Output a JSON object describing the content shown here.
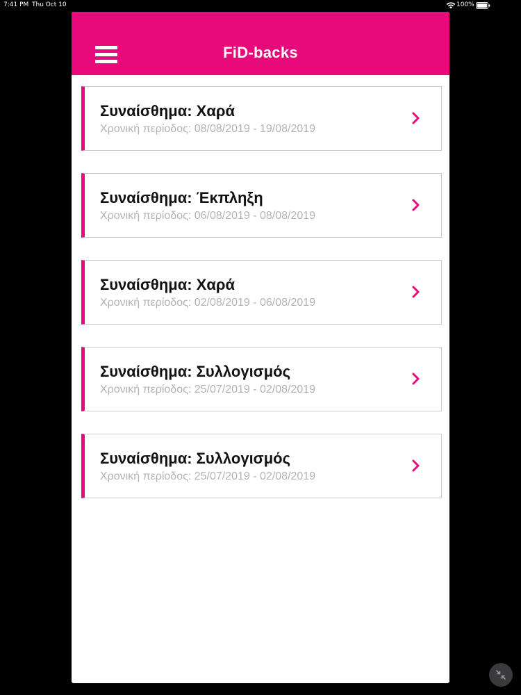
{
  "status_bar": {
    "time": "7:41 PM",
    "date": "Thu Oct 10",
    "battery": "100%",
    "icons": [
      "wifi-icon",
      "battery-icon"
    ]
  },
  "header": {
    "title": "FiD-backs",
    "menu_icon": "hamburger-menu-icon"
  },
  "colors": {
    "accent": "#e8097a",
    "background": "#000000",
    "card_border": "#c9c9c9",
    "subtitle": "#b3b3b3"
  },
  "items": [
    {
      "title": "Συναίσθημα: Χαρά",
      "period": "Χρονική περίοδος: 08/08/2019 - 19/08/2019",
      "icon": "chevron-right-icon"
    },
    {
      "title": "Συναίσθημα: Έκπληξη",
      "period": "Χρονική περίοδος: 06/08/2019 - 08/08/2019",
      "icon": "chevron-right-icon"
    },
    {
      "title": "Συναίσθημα: Χαρά",
      "period": "Χρονική περίοδος: 02/08/2019 - 06/08/2019",
      "icon": "chevron-right-icon"
    },
    {
      "title": "Συναίσθημα: Συλλογισμός",
      "period": "Χρονική περίοδος: 25/07/2019 - 02/08/2019",
      "icon": "chevron-right-icon"
    },
    {
      "title": "Συναίσθημα: Συλλογισμός",
      "period": "Χρονική περίοδος: 25/07/2019 - 02/08/2019",
      "icon": "chevron-right-icon"
    }
  ],
  "overlay": {
    "collapse_icon": "collapse-arrows-icon"
  }
}
